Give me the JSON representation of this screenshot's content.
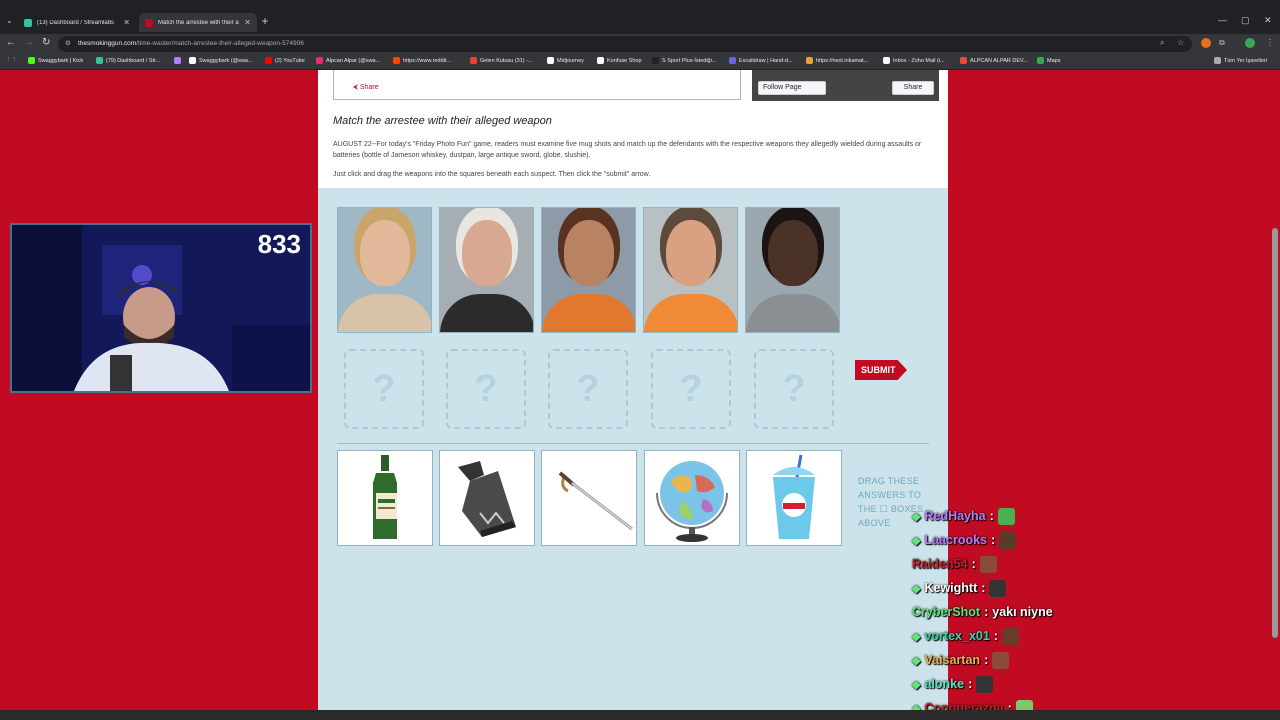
{
  "browser": {
    "tabs": [
      {
        "label": "(13) Dashboard / Streamlabs",
        "color": "#31c3a2"
      },
      {
        "label": "Match the arrestee with their a",
        "color": "#c10b22"
      }
    ],
    "url_host": "thesmokinggun.com",
    "url_path": "/time-waster/match-arrestee-their-alleged-weapon-574906",
    "bookmarks": [
      {
        "label": "Swaggybark | Kick",
        "color": "#53fc18"
      },
      {
        "label": "(79) Dashboard / Str...",
        "color": "#31c3a2"
      },
      {
        "label": "Swaggybark (@swa...",
        "color": "#ffffff"
      },
      {
        "label": "(2) YouTube",
        "color": "#ff0000"
      },
      {
        "label": "Alpcan Alpar (@swa...",
        "color": "#e1306c"
      },
      {
        "label": "https://www.reddit...",
        "color": "#ff4500"
      },
      {
        "label": "Gelen Kutusu (31) -...",
        "color": "#ea4335"
      },
      {
        "label": "Midjourney",
        "color": "#ffffff"
      },
      {
        "label": "Konfuse Shop",
        "color": "#ffffff"
      },
      {
        "label": "S Sport Plus-İstediği...",
        "color": "#222222"
      },
      {
        "label": "Excalidraw | Hand-d...",
        "color": "#6965db"
      },
      {
        "label": "https://next.inkamat...",
        "color": "#e8a040"
      },
      {
        "label": "Inbox - Zoho Mail (i...",
        "color": "#ffffff"
      },
      {
        "label": "ALPCAN ALPAR DEV...",
        "color": "#e74c3c"
      },
      {
        "label": "Maps",
        "color": "#34a853"
      }
    ],
    "bookmarks_all": "Tüm Yer İşaretleri"
  },
  "article": {
    "share_label": "Share",
    "fb_follow": "Follow Page",
    "fb_share": "Share",
    "headline": "Match the arrestee with their alleged weapon",
    "para1": "AUGUST 22--For today's \"Friday Photo Fun\" game, readers must examine five mug shots and match up the defendants with the respective weapons they allegedly wielded during assaults or batteries (bottle of Jameson whiskey, dustpan, large antique sword, globe, slushie).",
    "para2": "Just click and drag the weapons into the squares beneath each suspect. Then click the \"submit\" arrow."
  },
  "game": {
    "slot_mark": "?",
    "submit_label": "SUBMIT",
    "drag_note": "DRAG THESE ANSWERS TO THE ☐ BOXES ABOVE",
    "mugs": [
      {
        "bg": "#9fb8c6",
        "skin": "#e2b89a",
        "hair": "#c9a56a",
        "shirt": "#d9c3a8"
      },
      {
        "bg": "#a7aeb3",
        "skin": "#d8a890",
        "hair": "#e8e6e0",
        "shirt": "#2b2b2b"
      },
      {
        "bg": "#8d9ba8",
        "skin": "#b98363",
        "hair": "#5a3222",
        "shirt": "#e2782e"
      },
      {
        "bg": "#b9c0c3",
        "skin": "#d9a081",
        "hair": "#5c4a3a",
        "shirt": "#f08a36"
      },
      {
        "bg": "#9aa7ae",
        "skin": "#4a3228",
        "hair": "#1c1412",
        "shirt": "#8b8f94"
      }
    ],
    "weapons": [
      "jameson-bottle",
      "dustpan",
      "antique-sword",
      "globe",
      "slushie"
    ]
  },
  "stream": {
    "viewer_count": "833",
    "chat": [
      {
        "user": "RedHayha",
        "color": "#b57cf5",
        "text": "",
        "emote": "#4caf50"
      },
      {
        "user": "Laacrooks",
        "color": "#b57cf5",
        "text": "",
        "emote": "#5a3a2a"
      },
      {
        "user": "Raiden54",
        "color": "#c0202c",
        "text": "",
        "emote": "#8b4a3a"
      },
      {
        "user": "Kewightt",
        "color": "#ffffff",
        "text": "",
        "emote": "#333333"
      },
      {
        "user": "CryberShot",
        "color": "#5ee37a",
        "text": "yakı niyne",
        "emote": ""
      },
      {
        "user": "vortex_x01",
        "color": "#3fd0a8",
        "text": "",
        "emote": "#6a3a2a"
      },
      {
        "user": "Vaisartan",
        "color": "#f0b048",
        "text": "",
        "emote": "#8b4a3a"
      },
      {
        "user": "alonke",
        "color": "#5ee3c0",
        "text": "",
        "emote": "#333333"
      },
      {
        "user": "Conquerazna",
        "color": "#c0202c",
        "text": "",
        "emote": "#7bc96f"
      }
    ]
  }
}
